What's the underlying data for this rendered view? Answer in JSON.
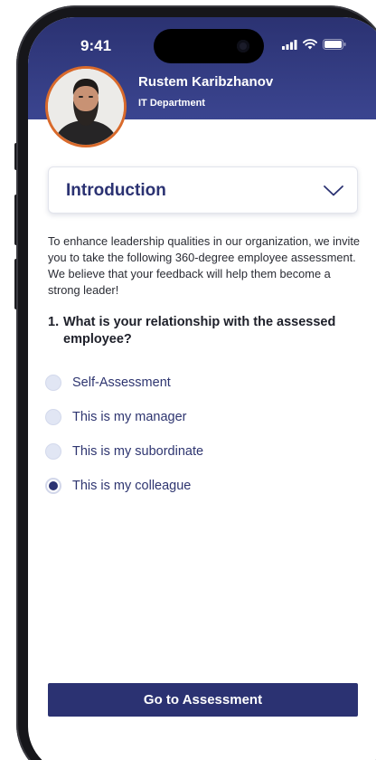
{
  "status_bar": {
    "time": "9:41",
    "icons": [
      "cellular-signal-icon",
      "wifi-icon",
      "battery-icon"
    ]
  },
  "profile": {
    "name": "Rustem Karibzhanov",
    "department": "IT Department"
  },
  "section_dropdown": {
    "selected": "Introduction",
    "icon": "chevron-down-icon"
  },
  "intro_text": "To enhance leadership qualities in our organization, we invite you to take the following 360-degree employee assessment. We believe that your feedback will help them become a strong leader!",
  "question": {
    "number": "1.",
    "text": "What is your relationship with the assessed employee?",
    "options": [
      {
        "label": "Self-Assessment",
        "selected": false
      },
      {
        "label": "This is my manager",
        "selected": false
      },
      {
        "label": "This is my subordinate",
        "selected": false
      },
      {
        "label": "This is my colleague",
        "selected": true
      }
    ]
  },
  "cta": {
    "label": "Go to Assessment"
  },
  "colors": {
    "primary": "#2b3272",
    "avatar_border": "#d96a2b",
    "radio_unchecked": "#e1e6f4",
    "text": "#2a2c34"
  }
}
